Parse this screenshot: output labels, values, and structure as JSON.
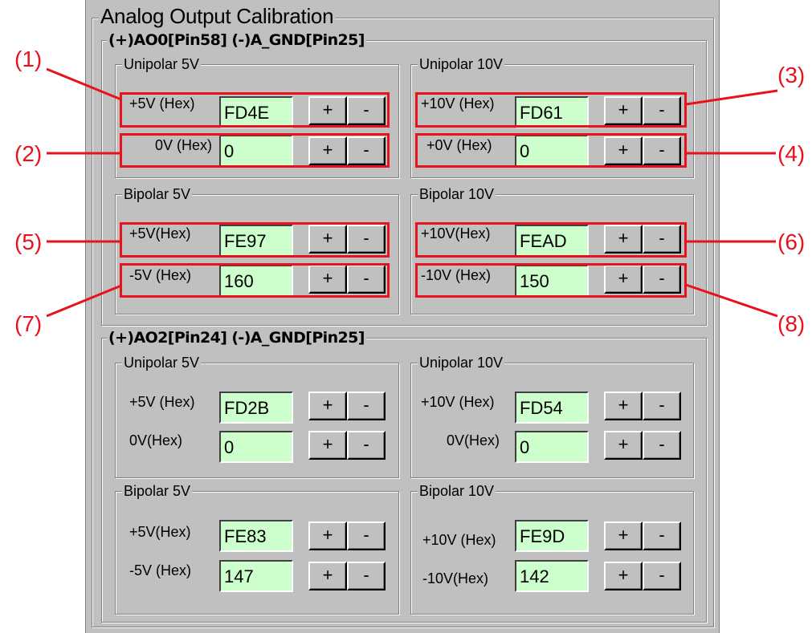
{
  "title": "Analog Output Calibration",
  "channels": [
    {
      "title": "(+)AO0[Pin58]   (-)A_GND[Pin25]",
      "groups": {
        "uni5": {
          "title": "Unipolar 5V",
          "rows": [
            {
              "label": "+5V (Hex)",
              "value": "FD4E"
            },
            {
              "label": "0V (Hex)",
              "value": "0"
            }
          ]
        },
        "uni10": {
          "title": "Unipolar 10V",
          "rows": [
            {
              "label": "+10V (Hex)",
              "value": "FD61"
            },
            {
              "label": "+0V (Hex)",
              "value": "0"
            }
          ]
        },
        "bi5": {
          "title": "Bipolar 5V",
          "rows": [
            {
              "label": "+5V(Hex)",
              "value": "FE97"
            },
            {
              "label": "-5V (Hex)",
              "value": "160"
            }
          ]
        },
        "bi10": {
          "title": "Bipolar 10V",
          "rows": [
            {
              "label": "+10V(Hex)",
              "value": "FEAD"
            },
            {
              "label": "-10V (Hex)",
              "value": "150"
            }
          ]
        }
      }
    },
    {
      "title": "(+)AO2[Pin24]   (-)A_GND[Pin25]",
      "groups": {
        "uni5": {
          "title": "Unipolar 5V",
          "rows": [
            {
              "label": "+5V (Hex)",
              "value": "FD2B"
            },
            {
              "label": "0V(Hex)",
              "value": "0"
            }
          ]
        },
        "uni10": {
          "title": "Unipolar 10V",
          "rows": [
            {
              "label": "+10V (Hex)",
              "value": "FD54"
            },
            {
              "label": "0V(Hex)",
              "value": "0"
            }
          ]
        },
        "bi5": {
          "title": "Bipolar 5V",
          "rows": [
            {
              "label": "+5V(Hex)",
              "value": "FE83"
            },
            {
              "label": "-5V (Hex)",
              "value": "147"
            }
          ]
        },
        "bi10": {
          "title": "Bipolar 10V",
          "rows": [
            {
              "label": "+10V (Hex)",
              "value": "FE9D"
            },
            {
              "label": "-10V(Hex)",
              "value": "142"
            }
          ]
        }
      }
    }
  ],
  "buttons": {
    "plus": "+",
    "minus": "-"
  },
  "callouts": [
    "(1)",
    "(2)",
    "(3)",
    "(4)",
    "(5)",
    "(6)",
    "(7)",
    "(8)"
  ],
  "colors": {
    "panel": "#c0c0c0",
    "input": "#ccffcc",
    "annotation": "#e8121c"
  }
}
